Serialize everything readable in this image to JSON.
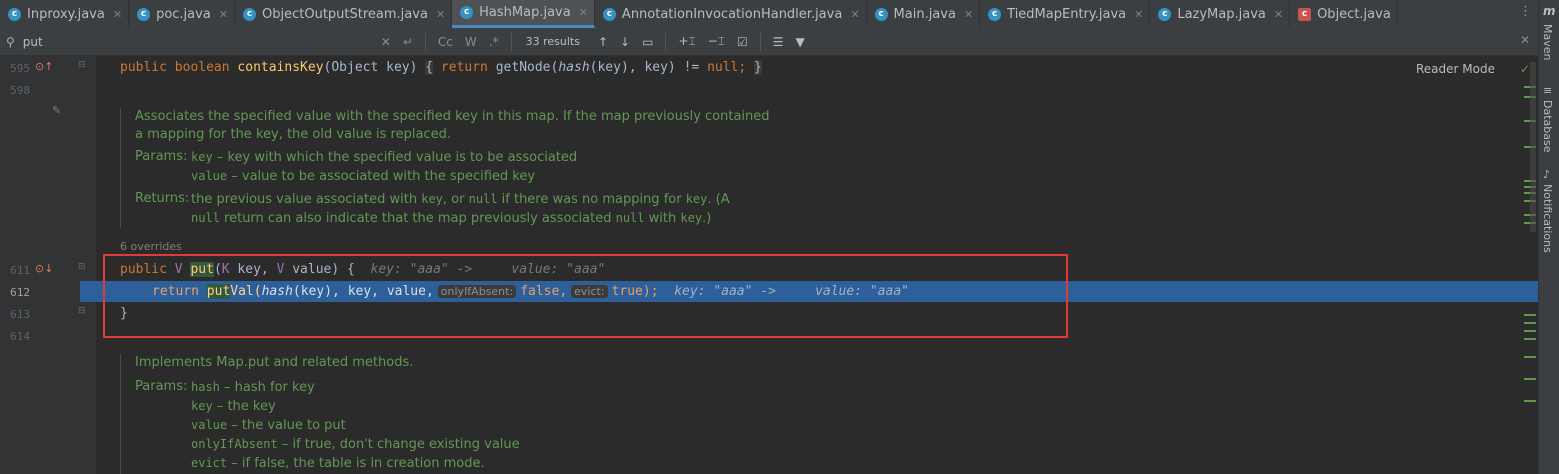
{
  "tabs": [
    {
      "label": "Inproxy.java",
      "icon": "class-icon",
      "active": false
    },
    {
      "label": "poc.java",
      "icon": "class-icon",
      "active": false
    },
    {
      "label": "ObjectOutputStream.java",
      "icon": "class-icon",
      "active": false
    },
    {
      "label": "HashMap.java",
      "icon": "class-icon",
      "active": true
    },
    {
      "label": "AnnotationInvocationHandler.java",
      "icon": "class-icon",
      "active": false
    },
    {
      "label": "Main.java",
      "icon": "class-icon",
      "active": false
    },
    {
      "label": "TiedMapEntry.java",
      "icon": "class-icon",
      "active": false
    },
    {
      "label": "LazyMap.java",
      "icon": "class-icon",
      "active": false
    },
    {
      "label": "Object.java",
      "icon": "object-class-icon",
      "active": false
    }
  ],
  "search": {
    "query": "put",
    "match_case": "Cc",
    "words": "W",
    "regex": ".*",
    "results": "33 results"
  },
  "editor": {
    "reader_mode": "Reader Mode",
    "line_numbers": {
      "l595": "595",
      "l598": "598",
      "l611": "611",
      "l612": "612",
      "l613": "613",
      "l614": "614"
    },
    "line595": {
      "kw1": "public",
      "kw2": "boolean",
      "fn": "containsKey",
      "p1": "(Object key)",
      "b1": "{",
      "kw3": "return",
      "call": "getNode(",
      "hash": "hash",
      "rest": "(key), key) !=",
      "null": "null",
      "semi": ";",
      "b2": "}"
    },
    "doc1": {
      "desc": "Associates the specified value with the specified key in this map. If the map previously contained a mapping for the key, the old value is replaced.",
      "params_label": "Params:",
      "p1_name": "key",
      "p1_desc": " – key with which the specified value is to be associated",
      "p2_name": "value",
      "p2_desc": " – value to be associated with the specified key",
      "returns_label": "Returns:",
      "r1": "the previous value associated with ",
      "r_key": "key",
      "r2": ", or ",
      "r_null": "null",
      "r3": " if there was no mapping for ",
      "r_key2": "key",
      "r4": ". (A ",
      "r_null2": "null",
      "r5": " return can also indicate that the map previously associated ",
      "r_null3": "null",
      "r6": " with ",
      "r_key3": "key",
      "r7": ".)"
    },
    "overrides": "6 overrides",
    "line611": {
      "kw": "public",
      "t1": "V",
      "fn": "put",
      "open": "(",
      "t2": "K",
      "p1": " key, ",
      "t3": "V",
      "p2": " value) {",
      "hint": "key: \"aaa\" ->     value: \"aaa\""
    },
    "line612": {
      "kw": "return",
      "fn_hl": "put",
      "fn_rest": "Val(",
      "hash": "hash",
      "args": "(key), key, value,",
      "pill1": "onlyIfAbsent:",
      "v1": "false,",
      "pill2": "evict:",
      "v2": "true);",
      "hint": "key: \"aaa\" ->     value: \"aaa\""
    },
    "line613": "}",
    "doc2": {
      "desc": "Implements Map.put and related methods.",
      "params_label": "Params:",
      "p1_name": "hash",
      "p1_desc": " – hash for key",
      "p2_name": "key",
      "p2_desc": " – the key",
      "p3_name": "value",
      "p3_desc": " – the value to put",
      "p4_name": "onlyIfAbsent",
      "p4_desc": " – if true, don't change existing value",
      "p5_name": "evict",
      "p5_desc": " – if false, the table is in creation mode."
    }
  },
  "rightbar": {
    "maven": "Maven",
    "database": "Database",
    "notifications": "Notifications",
    "m_logo": "m"
  }
}
